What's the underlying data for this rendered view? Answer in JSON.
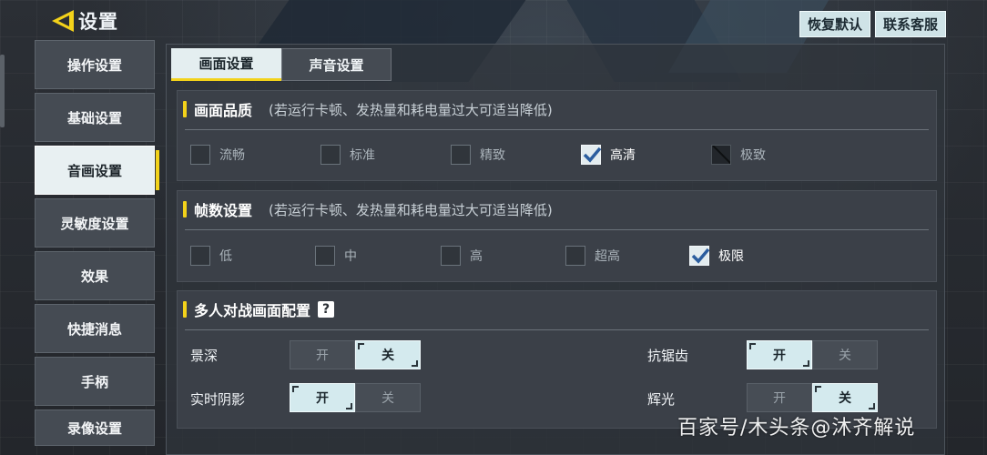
{
  "header": {
    "title": "设置"
  },
  "top_buttons": {
    "reset": "恢复默认",
    "support": "联系客服"
  },
  "sidebar": {
    "items": [
      {
        "label": "操作设置"
      },
      {
        "label": "基础设置"
      },
      {
        "label": "音画设置",
        "active": true
      },
      {
        "label": "灵敏度设置"
      },
      {
        "label": "效果"
      },
      {
        "label": "快捷消息"
      },
      {
        "label": "手柄"
      },
      {
        "label": "录像设置"
      }
    ]
  },
  "tabs": [
    {
      "label": "画面设置",
      "active": true
    },
    {
      "label": "声音设置",
      "active": false
    }
  ],
  "quality": {
    "title": "画面品质",
    "note": "(若运行卡顿、发热量和耗电量过大可适当降低)",
    "options": [
      {
        "label": "流畅",
        "state": "unchecked"
      },
      {
        "label": "标准",
        "state": "unchecked"
      },
      {
        "label": "精致",
        "state": "unchecked"
      },
      {
        "label": "高清",
        "state": "checked"
      },
      {
        "label": "极致",
        "state": "disabled"
      }
    ]
  },
  "framerate": {
    "title": "帧数设置",
    "note": "(若运行卡顿、发热量和耗电量过大可适当降低)",
    "options": [
      {
        "label": "低",
        "state": "unchecked"
      },
      {
        "label": "中",
        "state": "unchecked"
      },
      {
        "label": "高",
        "state": "unchecked"
      },
      {
        "label": "超高",
        "state": "unchecked"
      },
      {
        "label": "极限",
        "state": "checked"
      }
    ]
  },
  "multiplayer": {
    "title": "多人对战画面配置",
    "help": "?",
    "on_label": "开",
    "off_label": "关",
    "rows": [
      {
        "label": "景深",
        "value": "off"
      },
      {
        "label": "实时阴影",
        "value": "on"
      },
      {
        "label": "抗锯齿",
        "value": "on"
      },
      {
        "label": "辉光",
        "value": "off"
      }
    ]
  },
  "watermark": "百家号/木头条@沐齐解说",
  "colors": {
    "accent_yellow": "#f3d21a",
    "selected_bg": "#d4eaee",
    "panel_bg": "#3b4048"
  }
}
